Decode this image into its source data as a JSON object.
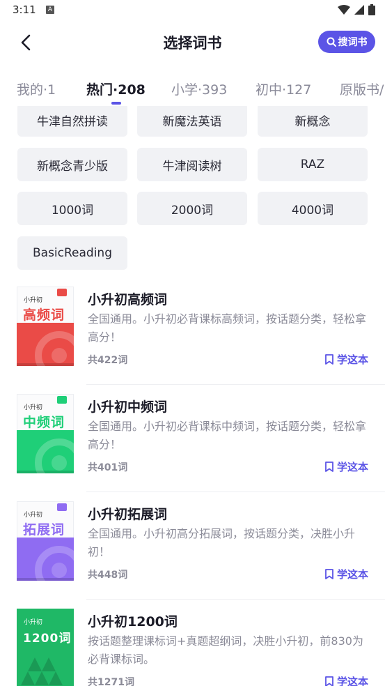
{
  "status": {
    "time": "3:11",
    "a_badge": "A"
  },
  "header": {
    "title": "选择词书",
    "search_label": "搜词书"
  },
  "tabs": [
    {
      "label": "我的·1"
    },
    {
      "label": "热门·208"
    },
    {
      "label": "小学·393"
    },
    {
      "label": "初中·127"
    },
    {
      "label": "原版书/"
    }
  ],
  "chips": [
    "牛津自然拼读",
    "新魔法英语",
    "新概念",
    "新概念青少版",
    "牛津阅读树",
    "RAZ",
    "1000词",
    "2000词",
    "4000词",
    "BasicReading"
  ],
  "books": [
    {
      "title": "小升初高频词",
      "desc": "全国通用。小升初必背课标高频词，按话题分类，轻松拿高分！",
      "count": "共422词",
      "learn": "学这本",
      "cover_small": "小升初",
      "cover_big": "高频词",
      "color": "#ea4b47"
    },
    {
      "title": "小升初中频词",
      "desc": "全国通用。小升初必背课标中频词，按话题分类，轻松拿高分！",
      "count": "共401词",
      "learn": "学这本",
      "cover_small": "小升初",
      "cover_big": "中频词",
      "color": "#1fcf78"
    },
    {
      "title": "小升初拓展词",
      "desc": "全国通用。小升初高分拓展词，按话题分类，决胜小升初！",
      "count": "共448词",
      "learn": "学这本",
      "cover_small": "小升初",
      "cover_big": "拓展词",
      "color": "#8f6cf2"
    },
    {
      "title": "小升初1200词",
      "desc": "按话题整理课标词+真题超纲词，决胜小升初，前830为必背课标词。",
      "count": "共1271词",
      "learn": "学这本",
      "cover_small": "小升初",
      "cover_big": "1200词",
      "color": "#1fb866"
    }
  ],
  "colors": {
    "accent": "#5b54e6"
  }
}
